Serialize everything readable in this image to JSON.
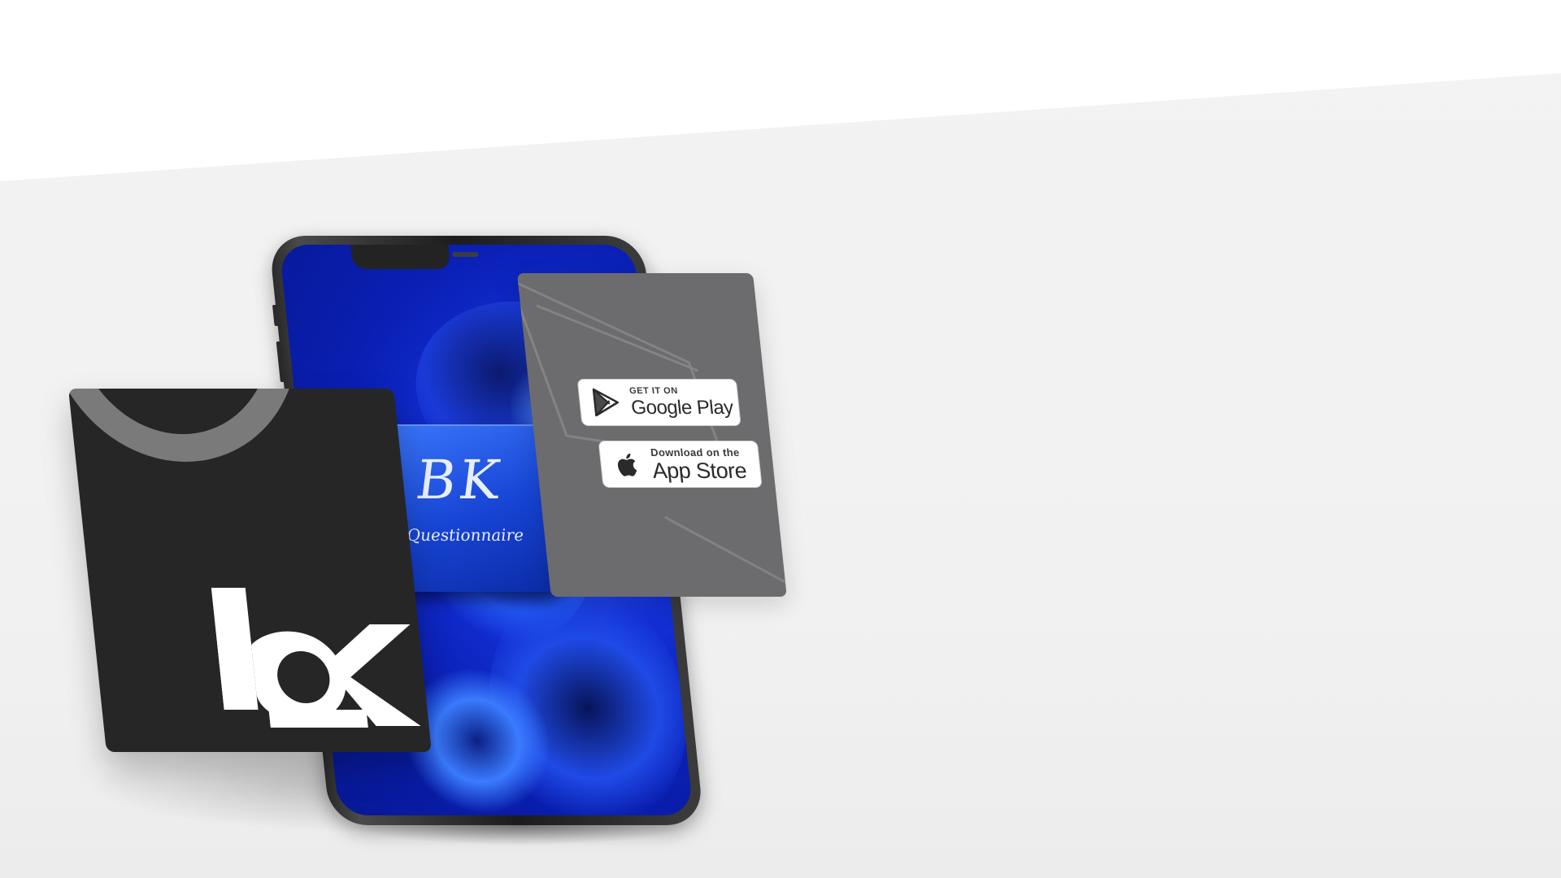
{
  "app_icon": {
    "title": "BK",
    "subtitle": "Questionnaire",
    "icon": "bk-questionnaire-app-icon"
  },
  "logo_card": {
    "icon": "bk-logo-icon",
    "colors": {
      "card": "#262626",
      "arc": "#7a7a7a",
      "mark": "#ffffff"
    }
  },
  "store_badges": {
    "google_play": {
      "small": "GET IT ON",
      "big": "Google Play",
      "icon": "google-play-icon"
    },
    "app_store": {
      "small": "Download on the",
      "big": "App Store",
      "icon": "apple-icon"
    }
  },
  "colors": {
    "background": "#f2f2f2",
    "screen_blue": "#1431d8",
    "store_card": "#6c6c6e"
  }
}
